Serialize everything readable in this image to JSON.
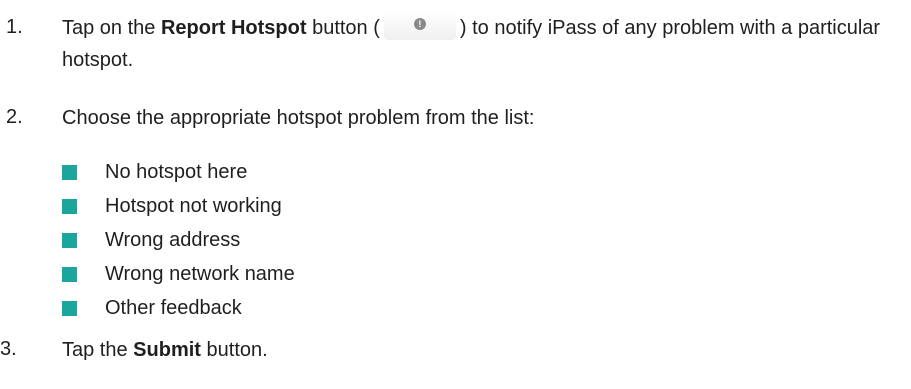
{
  "steps": [
    {
      "number": "1.",
      "before": "Tap on the ",
      "bold": "Report Hotspot",
      "middle": " button (",
      "after": ") to notify iPass of any problem with a particular hotspot."
    },
    {
      "number": "2.",
      "text": "Choose the appropriate hotspot problem from the list:"
    },
    {
      "number": "3.",
      "before": "Tap the ",
      "bold": "Submit",
      "after": " button."
    }
  ],
  "problems": [
    "No hotspot here",
    "Hotspot not working",
    "Wrong address",
    "Wrong network name",
    "Other feedback"
  ],
  "colors": {
    "bullet": "#1aa59d",
    "text": "#1f1f1f"
  },
  "icons": {
    "report_hotspot": "exclamation-circle-icon"
  }
}
